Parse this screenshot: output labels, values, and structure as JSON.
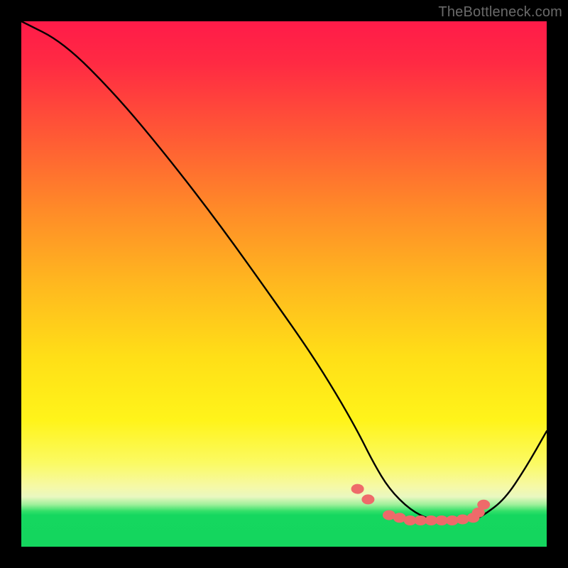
{
  "watermark": "TheBottleneck.com",
  "chart_data": {
    "type": "line",
    "title": "",
    "xlabel": "",
    "ylabel": "",
    "xlim": [
      0,
      100
    ],
    "ylim": [
      0,
      100
    ],
    "series": [
      {
        "name": "bottleneck-curve",
        "x": [
          0,
          8,
          18,
          28,
          38,
          48,
          55,
          60,
          64,
          67,
          70,
          74,
          78,
          82,
          86,
          88,
          92,
          96,
          100
        ],
        "y": [
          100,
          96,
          86,
          74,
          61,
          47,
          37,
          29,
          22,
          16,
          11,
          7,
          5,
          5,
          5,
          6,
          9,
          15,
          22
        ]
      }
    ],
    "markers": {
      "name": "highlight-points",
      "x": [
        64,
        66,
        70,
        72,
        74,
        76,
        78,
        80,
        82,
        84,
        86,
        87,
        88
      ],
      "y": [
        11,
        9,
        6,
        5.5,
        5,
        5,
        5,
        5,
        5,
        5.2,
        5.5,
        6.5,
        8
      ]
    },
    "colors": {
      "curve": "#000000",
      "marker_fill": "#ee6a6a",
      "marker_stroke": "#d94f4f"
    },
    "background_gradient": [
      "#ff1b49",
      "#ff8b28",
      "#ffdf17",
      "#f6f9a6",
      "#14d65e"
    ]
  }
}
